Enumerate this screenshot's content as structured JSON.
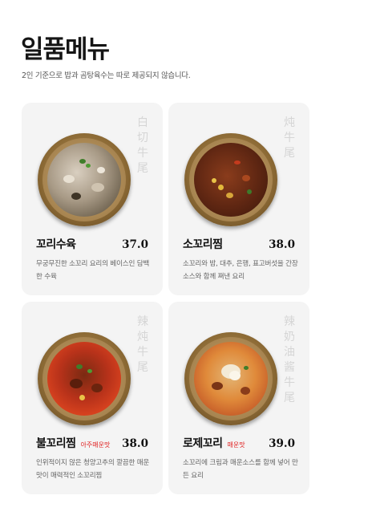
{
  "title": "일품메뉴",
  "subtitle": "2인 기준으로 밥과 곰탕육수는 따로 제공되지 않습니다.",
  "menu": [
    {
      "name": "꼬리수육",
      "badge": "",
      "price": "37.0",
      "vertical_label": "白切牛尾",
      "description": "무궁무진한 소꼬리 요리의 베이스인 담백한 수육"
    },
    {
      "name": "소꼬리찜",
      "badge": "",
      "price": "38.0",
      "vertical_label": "炖牛尾",
      "description": "소꼬리와 밤, 대추, 은행, 표고버섯을 간장소스와 함께 쪄낸 요리"
    },
    {
      "name": "불꼬리찜",
      "badge": "아주매운맛",
      "price": "38.0",
      "vertical_label": "辣炖牛尾",
      "description": "인위적이지 않은 청양고추의 깔끔한 매운맛이 매력적인 소꼬리찜"
    },
    {
      "name": "로제꼬리",
      "badge": "매운맛",
      "price": "39.0",
      "vertical_label": "辣奶油酱牛尾",
      "description": "소꼬리에 크림과 매운소스를 함께 넣어 만든 요리"
    }
  ],
  "colors": {
    "badge": "#e02020",
    "card_bg": "#f4f4f4",
    "vertical_label": "#d5d5d5"
  }
}
